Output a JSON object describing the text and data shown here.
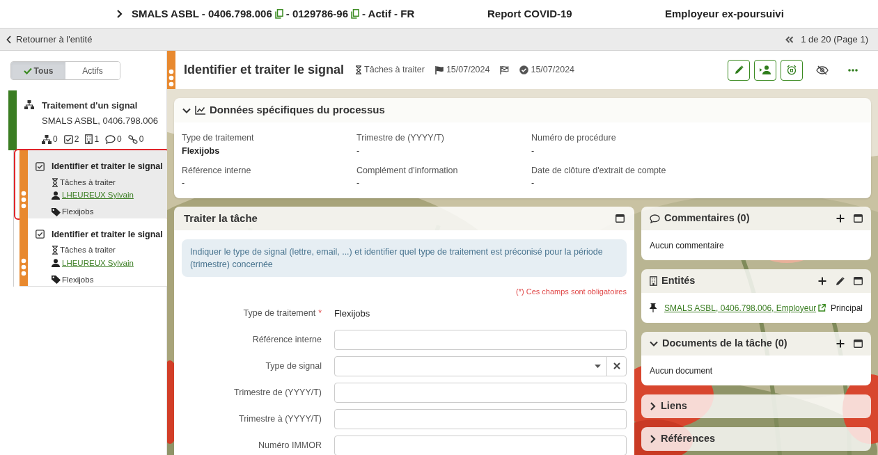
{
  "top_bar": {
    "entity_parts": [
      {
        "text": "SMALS ASBL - 0406.798.006",
        "copy": true
      },
      {
        "text": "- 0129786-96",
        "copy": true
      },
      {
        "text": "- Actif - FR",
        "copy": false
      }
    ],
    "labels": [
      "Report COVID-19",
      "Employeur ex-poursuivi"
    ]
  },
  "nav_bar": {
    "back": "Retourner à l'entité",
    "pager": "1 de 20 (Page 1)"
  },
  "filter_tabs": [
    {
      "label": "Tous",
      "selected": true
    },
    {
      "label": "Actifs",
      "selected": false
    }
  ],
  "tree": {
    "title": "Traitement d'un signal",
    "subtitle": "SMALS ASBL, 0406.798.006",
    "counts": [
      {
        "kind": "hierarchy",
        "value": "0"
      },
      {
        "kind": "tasks",
        "value": "2"
      },
      {
        "kind": "building",
        "value": "1"
      },
      {
        "kind": "comment",
        "value": "0"
      },
      {
        "kind": "link",
        "value": "0"
      }
    ],
    "children": [
      {
        "title": "Identifier et traiter le signal",
        "status": "Tâches à traiter",
        "assignee": "LHEUREUX Sylvain",
        "tag": "Flexijobs",
        "selected": true
      },
      {
        "title": "Identifier et traiter le signal",
        "status": "Tâches à traiter",
        "assignee": "LHEUREUX Sylvain",
        "tag": "Flexijobs",
        "selected": false
      }
    ]
  },
  "task_header": {
    "title": "Identifier et traiter le signal",
    "meta": [
      {
        "kind": "status",
        "text": "Tâches à traiter"
      },
      {
        "kind": "flag",
        "text": "15/07/2024"
      },
      {
        "kind": "finish"
      },
      {
        "kind": "done",
        "text": "15/07/2024"
      }
    ],
    "actions": [
      {
        "kind": "edit"
      },
      {
        "kind": "assign"
      },
      {
        "kind": "alarm"
      },
      {
        "kind": "hide"
      },
      {
        "kind": "more"
      }
    ]
  },
  "process_data": {
    "title": "Données spécifiques du processus",
    "expanded": true,
    "fields": [
      {
        "label": "Type de traitement",
        "value": "Flexijobs"
      },
      {
        "label": "Trimestre de (YYYY/T)",
        "value": "-"
      },
      {
        "label": "Numéro de procédure",
        "value": "-"
      },
      {
        "label": "Référence interne",
        "value": "-"
      },
      {
        "label": "Complément d'information",
        "value": "-"
      },
      {
        "label": "Date de clôture d'extrait de compte",
        "value": "-"
      }
    ]
  },
  "task_form": {
    "title": "Traiter la tâche",
    "info": "Indiquer le type de signal (lettre, email, ...) et identifier quel type de traitement est préconisé pour la période (trimestre) concernée",
    "required_note": "(*) Ces champs sont obligatoires",
    "fields": [
      {
        "label": "Type de traitement",
        "required_mark": "*",
        "kind": "text",
        "value": "Flexijobs"
      },
      {
        "label": "Référence interne",
        "kind": "input"
      },
      {
        "label": "Type de signal",
        "kind": "select"
      },
      {
        "label": "Trimestre de (YYYY/T)",
        "kind": "input"
      },
      {
        "label": "Trimestre à (YYYY/T)",
        "kind": "input"
      },
      {
        "label": "Numéro IMMOR",
        "kind": "input"
      }
    ]
  },
  "side_panels": [
    {
      "kind": "comments",
      "title": "Commentaires (0)",
      "actions": [
        {
          "kind": "add"
        },
        {
          "kind": "window"
        }
      ],
      "empty": "Aucun commentaire"
    },
    {
      "kind": "entities",
      "title": "Entités",
      "actions": [
        {
          "kind": "add"
        },
        {
          "kind": "edit"
        },
        {
          "kind": "window"
        }
      ],
      "items": [
        {
          "link": "SMALS ASBL, 0406.798.006, Employeur",
          "role": "Principal"
        }
      ]
    },
    {
      "kind": "section",
      "title": "Documents de la tâche (0)",
      "expanded": true,
      "actions": [
        {
          "kind": "add"
        },
        {
          "kind": "window"
        }
      ],
      "empty": "Aucun document"
    },
    {
      "kind": "section",
      "title": "Liens",
      "expanded": false
    },
    {
      "kind": "section",
      "title": "Références",
      "expanded": false
    }
  ]
}
